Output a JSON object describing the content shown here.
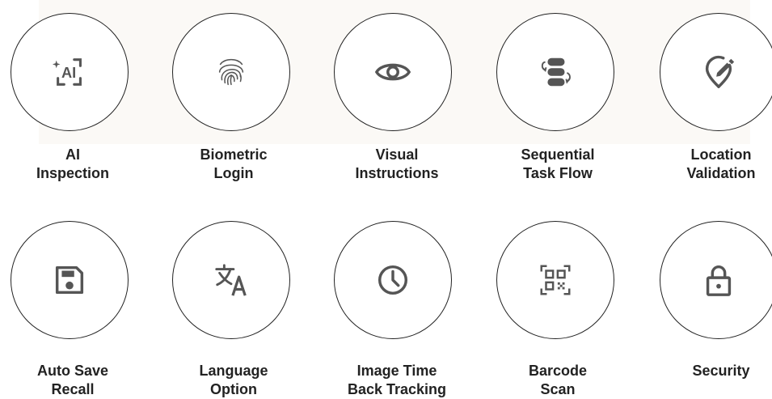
{
  "features": [
    {
      "icon": "ai-sparkle-icon",
      "line1": "AI",
      "line2": "Inspection"
    },
    {
      "icon": "fingerprint-icon",
      "line1": "Biometric",
      "line2": "Login"
    },
    {
      "icon": "eye-icon",
      "line1": "Visual",
      "line2": "Instructions"
    },
    {
      "icon": "sequential-flow-icon",
      "line1": "Sequential",
      "line2": "Task Flow"
    },
    {
      "icon": "location-pin-edit-icon",
      "line1": "Location",
      "line2": "Validation"
    },
    {
      "icon": "floppy-disk-icon",
      "line1": "Auto Save",
      "line2": "Recall"
    },
    {
      "icon": "translate-icon",
      "line1": "Language",
      "line2": "Option"
    },
    {
      "icon": "clock-icon",
      "line1": "Image Time",
      "line2": "Back Tracking"
    },
    {
      "icon": "barcode-scan-icon",
      "line1": "Barcode",
      "line2": "Scan"
    },
    {
      "icon": "lock-icon",
      "line1": "Security",
      "line2": ""
    }
  ],
  "colors": {
    "icon": "#555555",
    "text": "#222222",
    "circle_border": "#222222",
    "top_tint": "#fbf9f6"
  }
}
